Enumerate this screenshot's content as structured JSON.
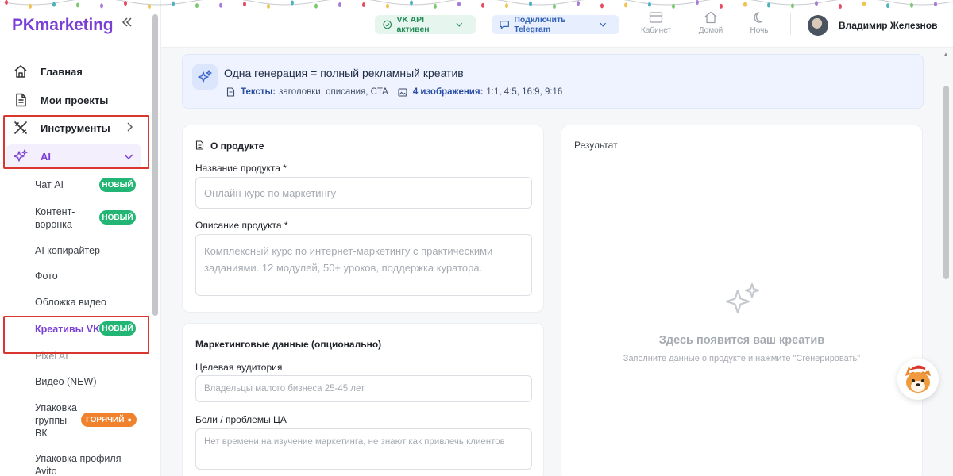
{
  "sidebar": {
    "logo": "PKmarketing",
    "collapse_icon": "double-chevron-left-icon",
    "nav": [
      {
        "label": "Главная",
        "icon": "home-icon"
      },
      {
        "label": "Мои проекты",
        "icon": "document-icon"
      },
      {
        "label": "Инструменты",
        "icon": "tools-icon"
      },
      {
        "label": "AI",
        "icon": "sparkles-icon"
      }
    ],
    "sub_items": [
      {
        "label": "Чат AI",
        "badge": "НОВЫЙ"
      },
      {
        "label": "Контент-воронка",
        "badge": "НОВЫЙ"
      },
      {
        "label": "AI копирайтер"
      },
      {
        "label": "Фото"
      },
      {
        "label": "Обложка видео"
      },
      {
        "label": "Креативы VK",
        "badge": "НОВЫЙ",
        "active": true
      },
      {
        "label": "Pixel AI"
      },
      {
        "label": "Видео (NEW)"
      },
      {
        "label": "Упаковка группы ВК",
        "badge": "ГОРЯЧИЙ"
      },
      {
        "label": "Упаковка профиля Avito"
      }
    ]
  },
  "topbar": {
    "vk_status": "VK API активен",
    "telegram": "Подключить Telegram",
    "icons": [
      {
        "label": "Кабинет",
        "icon": "wallet-icon"
      },
      {
        "label": "Домой",
        "icon": "home-icon"
      },
      {
        "label": "Ночь",
        "icon": "moon-icon"
      }
    ],
    "user_name": "Владимир Железнов"
  },
  "banner": {
    "title": "Одна генерация = полный рекламный креатив",
    "texts_label": "Тексты:",
    "texts_value": "заголовки, описания, CTA",
    "images_label": "4 изображения:",
    "images_value": "1:1, 4:5, 16:9, 9:16"
  },
  "product_card": {
    "title": "О продукте",
    "name_label": "Название продукта *",
    "name_placeholder": "Онлайн-курс по маркетингу",
    "desc_label": "Описание продукта *",
    "desc_placeholder": "Комплексный курс по интернет-маркетингу с практическими заданиями. 12 модулей, 50+ уроков, поддержка куратора."
  },
  "marketing_card": {
    "title": "Маркетинговые данные (опционально)",
    "audience_label": "Целевая аудитория",
    "audience_placeholder": "Владельцы малого бизнеса 25-45 лет",
    "pains_label": "Боли / проблемы ЦА",
    "pains_placeholder": "Нет времени на изучение маркетинга, не знают как привлечь клиентов"
  },
  "result_card": {
    "title": "Результат",
    "empty_title": "Здесь появится ваш креатив",
    "empty_sub": "Заполните данные о продукте и нажмите \"Сгенерировать\""
  },
  "colors": {
    "brand": "#7a3fd6",
    "badge_new": "#22b573",
    "badge_hot": "#f0822e",
    "highlight_box": "#d9362f"
  }
}
